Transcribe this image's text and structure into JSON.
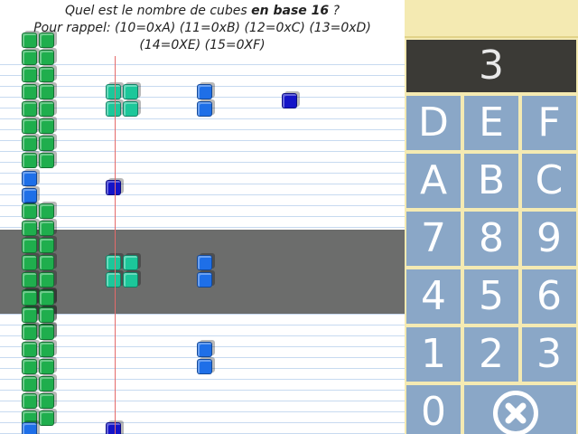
{
  "question": {
    "line1_prefix": "Quel est le nombre de cubes ",
    "line1_bold": "en base 16",
    "line1_suffix": " ?",
    "line2": "Pour rappel: (10=0xA) (11=0xB) (12=0xC) (13=0xD)",
    "line3": "(14=0XE) (15=0XF)"
  },
  "rows": [
    {
      "selected": false,
      "groups": [
        {
          "color": "green",
          "count": 16
        },
        {
          "color": "teal",
          "count": 4
        },
        {
          "color": "blue",
          "count": 2
        },
        {
          "color": "navy",
          "count": 1
        }
      ]
    },
    {
      "selected": false,
      "groups": [
        {
          "color": "blue",
          "count": 2
        },
        {
          "color": "navy",
          "count": 1
        }
      ]
    },
    {
      "selected": true,
      "groups": [
        {
          "color": "green",
          "count": 16
        },
        {
          "color": "teal",
          "count": 4
        },
        {
          "color": "blue",
          "count": 2
        }
      ]
    },
    {
      "selected": false,
      "groups": [
        {
          "color": "green",
          "count": 16
        },
        {
          "color": "blue",
          "count": 2
        }
      ]
    },
    {
      "selected": false,
      "groups": [
        {
          "color": "blue",
          "count": 1
        },
        {
          "color": "navy",
          "count": 1
        }
      ]
    }
  ],
  "keypad": {
    "display_value": "3",
    "keys": [
      "D",
      "E",
      "F",
      "A",
      "B",
      "C",
      "7",
      "8",
      "9",
      "4",
      "5",
      "6",
      "1",
      "2",
      "3",
      "0"
    ],
    "clear_icon": "close-circle-icon"
  },
  "colors": {
    "green": "#1fae4d",
    "teal": "#1cc79a",
    "blue": "#1e6fe8",
    "navy": "#1414c8",
    "key_background": "#8aa7c7",
    "display_background": "#3b3a36",
    "selected_row": "#6c6d6c",
    "keypad_frame": "#f4eab2"
  }
}
